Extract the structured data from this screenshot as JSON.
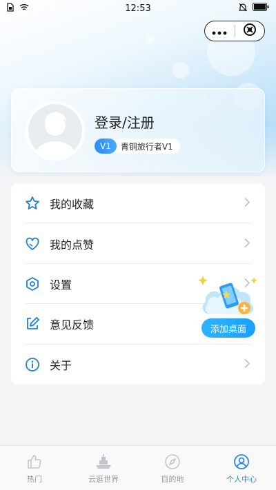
{
  "status_bar": {
    "carrier_icon": "sim-card-icon",
    "wifi_icon": "wifi-icon",
    "time": "12:53",
    "mute_icon": "bell-off-icon",
    "battery_icon": "battery-icon"
  },
  "capsule": {
    "more_icon": "more-dots-icon",
    "close_icon": "close-circle-icon"
  },
  "profile": {
    "login_label": "登录/注册",
    "level_code": "V1",
    "level_name": "青铜旅行者V1"
  },
  "menu": {
    "items": [
      {
        "label": "我的收藏",
        "icon": "star-icon"
      },
      {
        "label": "我的点赞",
        "icon": "heart-icon"
      },
      {
        "label": "设置",
        "icon": "settings-icon"
      },
      {
        "label": "意见反馈",
        "icon": "feedback-icon"
      },
      {
        "label": "关于",
        "icon": "info-icon"
      }
    ]
  },
  "add_desktop": {
    "label": "添加桌面"
  },
  "tabs": [
    {
      "label": "热门",
      "icon": "thumbs-up-icon",
      "active": false
    },
    {
      "label": "云逛世界",
      "icon": "ship-icon",
      "active": false
    },
    {
      "label": "目的地",
      "icon": "compass-icon",
      "active": false
    },
    {
      "label": "个人中心",
      "icon": "user-icon",
      "active": true
    }
  ],
  "colors": {
    "accent": "#2d86e8",
    "icon_blue": "#1e7fd8",
    "inactive": "#999999"
  }
}
